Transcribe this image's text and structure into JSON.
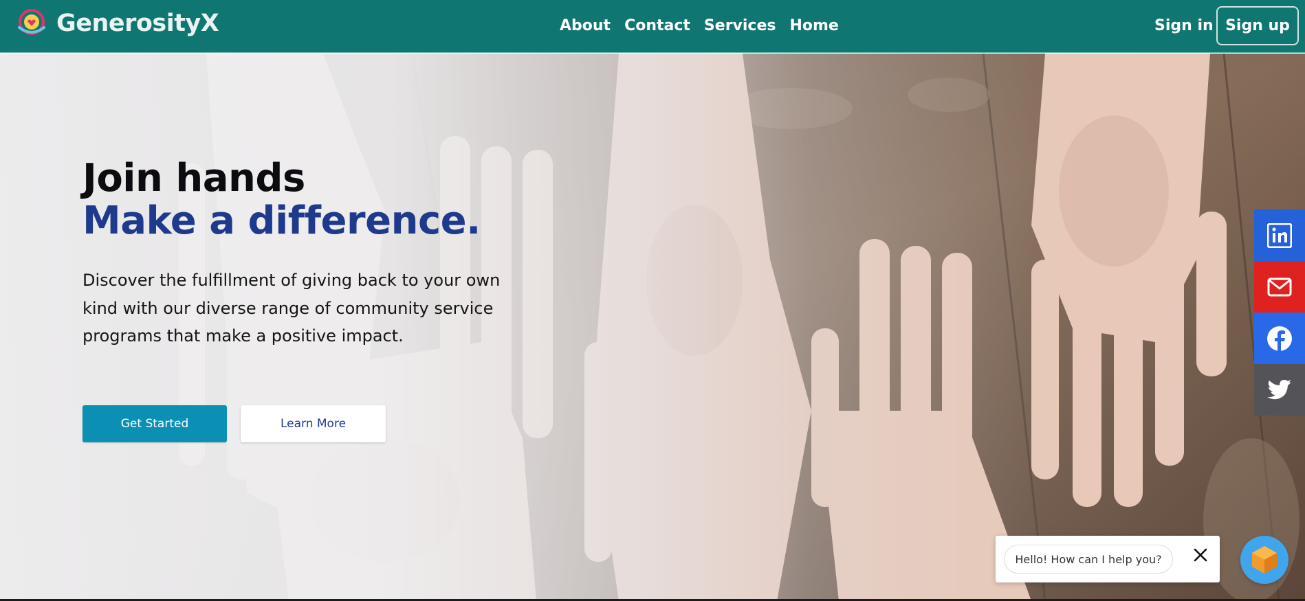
{
  "nav": {
    "brand": "GenerosityX",
    "links": [
      "About",
      "Contact",
      "Services",
      "Home"
    ],
    "sign_in": "Sign in",
    "sign_up": "Sign up"
  },
  "hero": {
    "title_line1": "Join hands",
    "title_line2": "Make a difference.",
    "description": "Discover the fulfillment of giving back to your own kind with our diverse range of community service programs that make a positive impact.",
    "primary_button": "Get Started",
    "secondary_button": "Learn More"
  },
  "social": {
    "items": [
      "linkedin-icon",
      "mail-icon",
      "facebook-icon",
      "twitter-icon"
    ],
    "colors": [
      "#2561d8",
      "#df2120",
      "#2968e6",
      "#545458"
    ]
  },
  "chat": {
    "greeting": "Hello! How can I help you?"
  },
  "colors": {
    "nav_bg": "#0f7671",
    "accent_blue": "#1f3a8d",
    "primary_button": "#0b8fb3"
  }
}
